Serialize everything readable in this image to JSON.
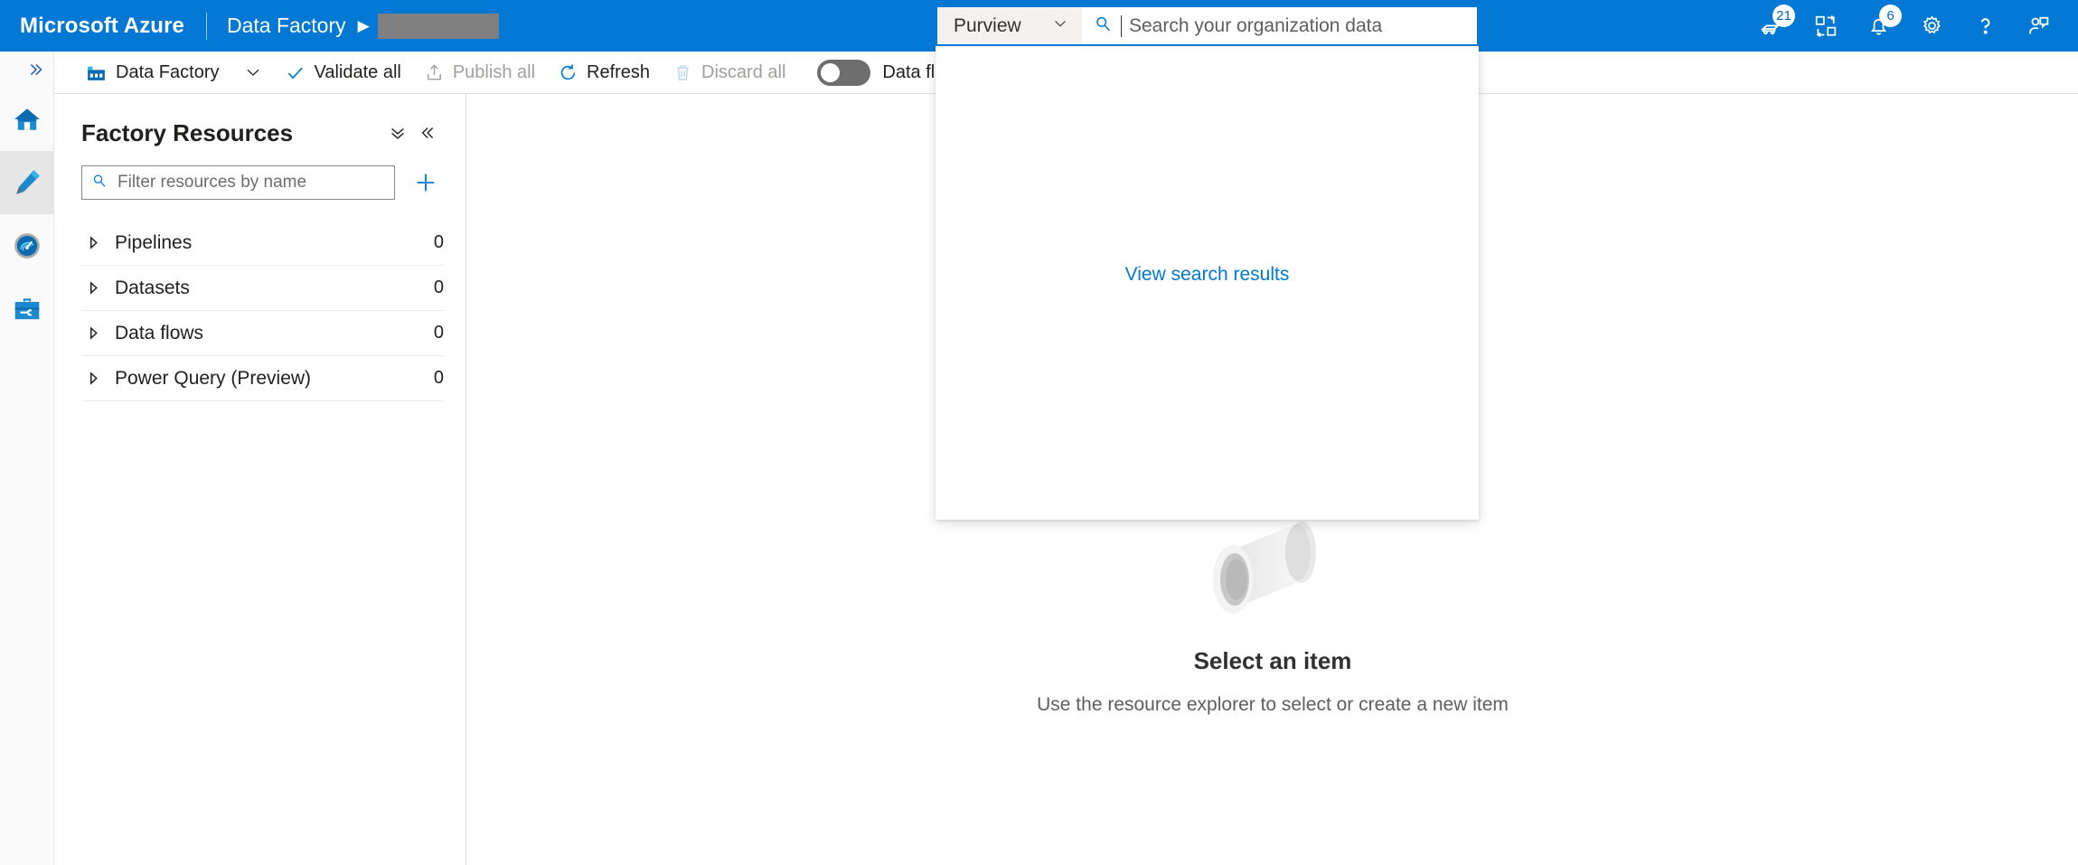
{
  "topbar": {
    "brand": "Microsoft Azure",
    "breadcrumb_root": "Data Factory",
    "breadcrumb_caret": "▶",
    "breadcrumb_redacted_label": "redacted-resource-name",
    "accent_color": "#0078d4"
  },
  "search": {
    "scope": "Purview",
    "placeholder": "Search your organization data",
    "value": "",
    "flyout": {
      "view_results_label": "View search results"
    }
  },
  "top_actions": [
    {
      "name": "cloud-shell-icon",
      "badge": "21"
    },
    {
      "name": "directory-switcher-icon",
      "badge": ""
    },
    {
      "name": "notifications-bell-icon",
      "badge": "6"
    },
    {
      "name": "settings-gear-icon",
      "badge": ""
    },
    {
      "name": "help-question-icon",
      "badge": ""
    },
    {
      "name": "feedback-person-icon",
      "badge": ""
    }
  ],
  "rail": {
    "expand_glyph": "»",
    "items": [
      {
        "name": "home",
        "selected": false
      },
      {
        "name": "author",
        "selected": true
      },
      {
        "name": "monitor",
        "selected": false
      },
      {
        "name": "manage",
        "selected": false
      }
    ]
  },
  "toolbar": {
    "factory_label": "Data Factory",
    "validate_all": "Validate all",
    "publish_all": "Publish all",
    "refresh": "Refresh",
    "discard_all": "Discard all",
    "data_flow_debug": "Data flow debug",
    "toggle_on": false
  },
  "resources": {
    "title": "Factory Resources",
    "filter_placeholder": "Filter resources by name",
    "filter_value": "",
    "tree": [
      {
        "label": "Pipelines",
        "count": "0"
      },
      {
        "label": "Datasets",
        "count": "0"
      },
      {
        "label": "Data flows",
        "count": "0"
      },
      {
        "label": "Power Query (Preview)",
        "count": "0"
      }
    ]
  },
  "canvas": {
    "empty_title": "Select an item",
    "empty_subtitle": "Use the resource explorer to select or create a new item"
  }
}
